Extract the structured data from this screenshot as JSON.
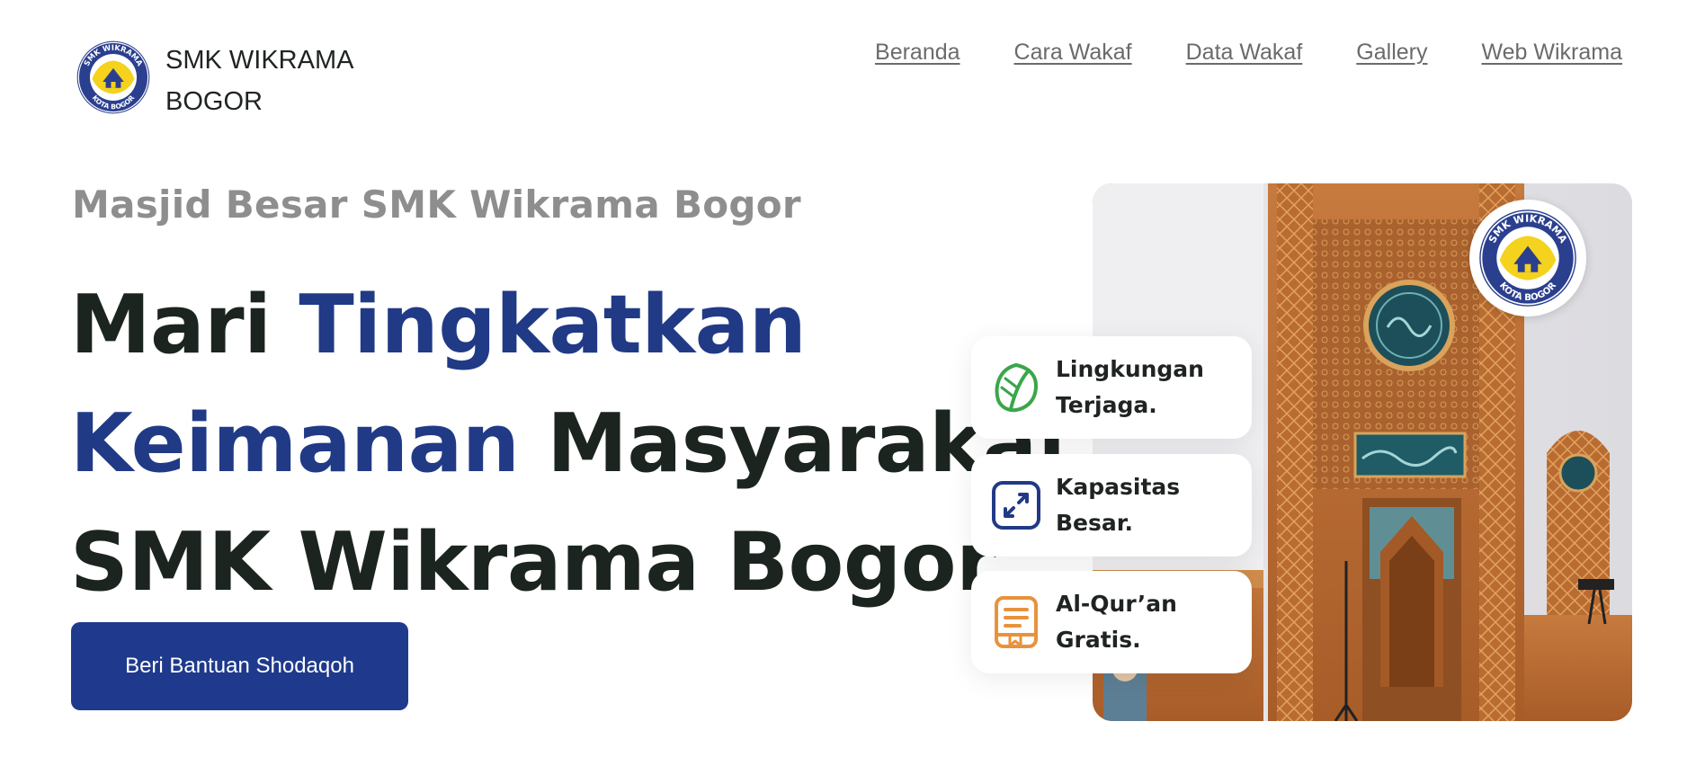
{
  "header": {
    "brand_line1": "SMK WIKRAMA",
    "brand_line2": "BOGOR",
    "nav": [
      "Beranda",
      "Cara Wakaf",
      "Data Wakaf",
      "Gallery",
      "Web Wikrama"
    ]
  },
  "hero": {
    "subtitle": "Masjid Besar SMK Wikrama Bogor",
    "headline_1a": "Mari ",
    "headline_1b": "Tingkatkan",
    "headline_2a": "Keimanan",
    "headline_2b": " Masyarakat",
    "headline_3": "SMK Wikrama Bogor",
    "cta_label": "Beri Bantuan Shodaqoh"
  },
  "features": [
    {
      "line1": "Lingkungan",
      "line2": "Terjaga.",
      "icon": "leaf-icon",
      "color": "#3aa64a"
    },
    {
      "line1": "Kapasitas",
      "line2": "Besar.",
      "icon": "expand-icon",
      "color": "#213a86"
    },
    {
      "line1": "Al-Qur’an",
      "line2": "Gratis.",
      "icon": "book-icon",
      "color": "#e8923c"
    }
  ],
  "logo_text": {
    "top": "SMK WIKRAMA",
    "bottom": "KOTA BOGOR"
  },
  "colors": {
    "primary": "#1f3a8c",
    "headline_blue": "#213a86",
    "text_dark": "#1c2420",
    "muted": "#8e8e8e"
  }
}
